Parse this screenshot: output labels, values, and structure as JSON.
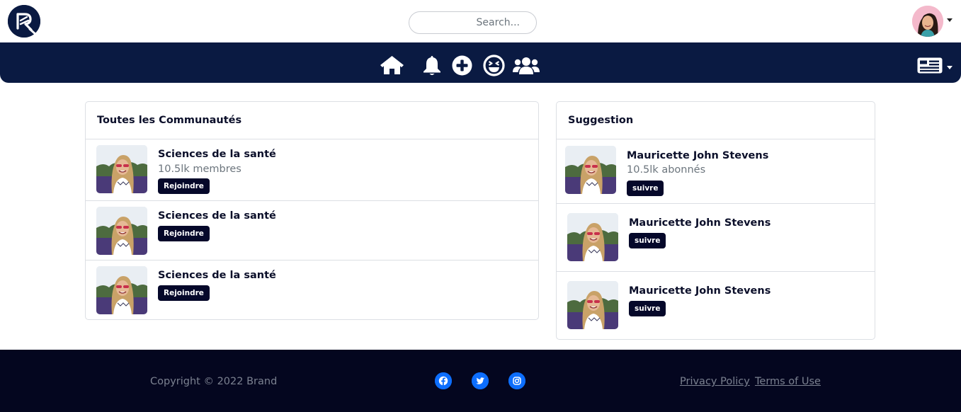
{
  "header": {
    "logo_icon": "brand-logo",
    "search": {
      "placeholder": "Search..."
    },
    "user_avatar_icon": "user-avatar",
    "menu_caret_icon": "caret-down-icon"
  },
  "navbar": {
    "icons": [
      "home-icon",
      "bell-icon",
      "plus-circle-icon",
      "laugh-squint-icon",
      "users-icon"
    ],
    "right_menu_icon": "newspaper-icon",
    "background": "#0a1a42"
  },
  "communities": {
    "title": "Toutes les Communautés",
    "items": [
      {
        "name": "Sciences de la santé",
        "members": "10.5lk membres",
        "action": "Rejoindre"
      },
      {
        "name": "Sciences de la santé",
        "action": "Rejoindre"
      },
      {
        "name": "Sciences de la santé",
        "action": "Rejoindre"
      }
    ]
  },
  "suggestions": {
    "title": "Suggestion",
    "items": [
      {
        "name": "Mauricette John Stevens",
        "followers": "10.5lk abonnés",
        "action": "suivre"
      },
      {
        "name": "Mauricette John Stevens",
        "action": "suivre"
      },
      {
        "name": "Mauricette John Stevens",
        "action": "suivre"
      }
    ]
  },
  "footer": {
    "copyright": "Copyright © 2022 Brand",
    "social_icons": [
      "facebook-icon",
      "twitter-icon",
      "instagram-icon"
    ],
    "links": [
      "Privacy Policy",
      "Terms of Use"
    ],
    "background": "#04061f"
  },
  "colors": {
    "accent": "#0a1a42",
    "button": "#05082a",
    "social": "#0d6efd"
  }
}
